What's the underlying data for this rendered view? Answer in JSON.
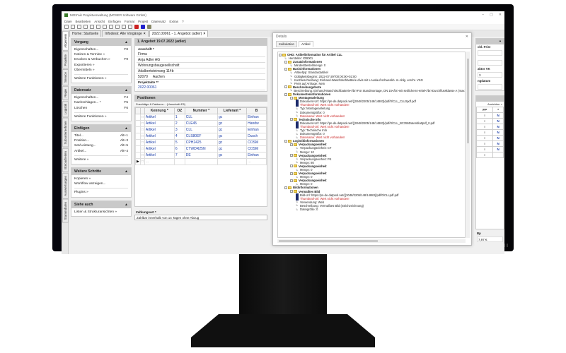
{
  "window": {
    "title": "MOS'aik Projektverwaltung (MOSER Software GmbH)",
    "controls": [
      "–",
      "▢",
      "✕"
    ]
  },
  "menu": [
    "Datei",
    "Bearbeiten",
    "Ansicht",
    "Einfügen",
    "Format",
    "Projekt",
    "Datensatz",
    "Extras",
    "?"
  ],
  "side_tabs": [
    "Allgemein",
    "Projekte",
    "Service",
    "Regie",
    "Logistik",
    "Subunternehmer",
    "Büroarbeiten",
    "Auswertungen",
    "Stammdaten"
  ],
  "doc_tabs": [
    {
      "label": "Home: Startseite",
      "closable": false
    },
    {
      "label": "Infodesk: Alle Vorgänge",
      "closable": true
    },
    {
      "label": "2022.00061 - 1. Angebot (adler)",
      "closable": true,
      "active": true
    }
  ],
  "panels": [
    {
      "title": "Vorgang",
      "items": [
        {
          "label": "Eigenschaften...",
          "key": "F8"
        },
        {
          "label": "Notizen & Termine »",
          "key": ""
        },
        {
          "label": "Drucken & Verbuchen »",
          "key": "F9"
        },
        {
          "label": "Exportieren »",
          "key": ""
        },
        {
          "label": "Übermitteln »",
          "key": ""
        }
      ],
      "more": "Weitere Funktionen »"
    },
    {
      "title": "Datensatz",
      "items": [
        {
          "label": "Eigenschaften...",
          "key": "F4"
        },
        {
          "label": "Nachschlagen... *",
          "key": "F5"
        },
        {
          "label": "Löschen",
          "key": "F6"
        }
      ],
      "more": "Weitere Funktionen »"
    },
    {
      "title": "Einfügen",
      "items": [
        {
          "label": "Titel...",
          "key": "Alt+1"
        },
        {
          "label": "Position...",
          "key": "Alt+3"
        },
        {
          "label": "Set/Leistung...",
          "key": "Alt+5"
        },
        {
          "label": "Artikel...",
          "key": "Alt+4"
        }
      ],
      "more": "Weitere »"
    },
    {
      "title": "Weitere Schritte",
      "items": [
        {
          "label": "Kopieren »",
          "key": ""
        },
        {
          "label": "Workflow anzeigen...",
          "key": ""
        }
      ],
      "more": "Plugins »"
    },
    {
      "title": "Siehe auch",
      "items": [
        {
          "label": "Listen & Strukturansichten »",
          "key": ""
        }
      ],
      "more": null
    }
  ],
  "document": {
    "header": "1. Angebot 19.07.2022 (adler)",
    "address_label": "Anschrift *",
    "address_lines": [
      "Firma",
      "Anja Adler AG",
      "Wohnungsbaugesellschaft",
      "Adalbertsteinweg 114b"
    ],
    "zip": "52070",
    "city": "Aachen",
    "project_label": "Projektakte **",
    "project_value": "2022.00061",
    "positions_header": "Positionen",
    "positions_toolbar": "Zuschläge & Faktoren... (Umschalt+F8)",
    "columns": [
      "Kennung *",
      "OZ",
      "Nummer *",
      "Lieferant *",
      "B"
    ],
    "rows": [
      [
        "Artikel",
        "1",
        "CLL",
        "gc",
        "Einhan"
      ],
      [
        "Artikel",
        "2",
        "CLE45",
        "gc",
        "Handw"
      ],
      [
        "Artikel",
        "3",
        "CLL",
        "gc",
        "Einhan"
      ],
      [
        "Artikel",
        "4",
        "CLS80EF",
        "gc",
        "Dusch"
      ],
      [
        "Artikel",
        "5",
        "CPH2425",
        "gc",
        "COSM"
      ],
      [
        "Artikel",
        "6",
        "CTWDR25N",
        "gc",
        "COSM"
      ],
      [
        "Artikel",
        "7",
        "DE",
        "gc",
        "Einhan"
      ]
    ],
    "new_row_placeholder": "...",
    "payment_label": "Zahlungsart *",
    "payment_value": "Zahlbar innerhalb von 14 Tagen ohne Abzug"
  },
  "details": {
    "title": "Details",
    "tabs": [
      "Kalkulation",
      "Artikel"
    ],
    "active_tab": "Artikel",
    "tree": [
      {
        "level": 0,
        "type": "folder",
        "fold": "-",
        "bold": true,
        "text": "OHD: Artikelinformation für Artikel CLL"
      },
      {
        "level": 1,
        "type": "attr",
        "text": "Hersteller: IDB001"
      },
      {
        "level": 1,
        "type": "folder",
        "fold": "-",
        "bold": true,
        "text": "Zusatzinformationen"
      },
      {
        "level": 2,
        "type": "attr",
        "text": "Mindestbestellmenge: 0"
      },
      {
        "level": 1,
        "type": "folder",
        "fold": "-",
        "bold": true,
        "text": "Basisinformationen"
      },
      {
        "level": 2,
        "type": "attr",
        "text": "Artikeltyp: Standardartikel"
      },
      {
        "level": 2,
        "type": "attr",
        "text": "Gültigkeitsbeginn: 2022-07-29T00:00:00+02:00"
      },
      {
        "level": 2,
        "type": "attr",
        "text": "Kurzbeschreibung: Einhand-Waschtischbatterie divis mit LAuslauf schwenkb. m.Ablg. verchr. VSG"
      },
      {
        "level": 2,
        "type": "attr",
        "text": "Preis auf Anfrage: Nein"
      },
      {
        "level": 1,
        "type": "folder",
        "fold": "-",
        "bold": true,
        "text": "Beschreibungstexte"
      },
      {
        "level": 2,
        "type": "attr",
        "text": "Beschreibung: Einhand-Waschtischbatterie</br>Für Standmontage, DN 15</br>mit seitlichem Hebel</br>Durchflussklasse A (max. 0,25l..."
      },
      {
        "level": 1,
        "type": "folder",
        "fold": "-",
        "bold": true,
        "text": "Dokumenteninformationen"
      },
      {
        "level": 2,
        "type": "folder",
        "fold": "-",
        "bold": true,
        "text": "Montageanleitung"
      },
      {
        "level": 3,
        "type": "doc",
        "text": "Dokument-Url: https://pn-de.datpool.net/{{3048/2205/148/14883}/pdf/0/CLL_CLL0pdf.pdf"
      },
      {
        "level": 3,
        "type": "doc",
        "error": true,
        "text": "Thumbnail-Url: Wert nicht vorhanden!"
      },
      {
        "level": 3,
        "type": "attr",
        "text": "Typ: Montageanleitung"
      },
      {
        "level": 3,
        "type": "attr",
        "text": "Dokumentgröße: 0"
      },
      {
        "level": 3,
        "type": "attr",
        "error": true,
        "text": "Dateiname: Wert nicht vorhanden!"
      },
      {
        "level": 2,
        "type": "folder",
        "fold": "-",
        "bold": true,
        "text": "Technische Info"
      },
      {
        "level": 3,
        "type": "doc",
        "text": "Dokument-Url: https://pn-de.datpool.net/{{3048/2205/148/14883}/pdf/0/CLL_BC355Datenblattpdf_0.pdf"
      },
      {
        "level": 3,
        "type": "doc",
        "error": true,
        "text": "Thumbnail-Url: Wert nicht vorhanden!"
      },
      {
        "level": 3,
        "type": "attr",
        "text": "Typ: Technische Info"
      },
      {
        "level": 3,
        "type": "attr",
        "text": "Dokumentgröße: 0"
      },
      {
        "level": 3,
        "type": "attr",
        "error": true,
        "text": "Dateiname: Wert nicht vorhanden!"
      },
      {
        "level": 1,
        "type": "folder",
        "fold": "-",
        "bold": true,
        "text": "Logistikinformationen"
      },
      {
        "level": 2,
        "type": "folder",
        "fold": "-",
        "bold": true,
        "text": "Verpackungseinheit"
      },
      {
        "level": 3,
        "type": "attr",
        "text": "Verpackungseinheit: CT"
      },
      {
        "level": 3,
        "type": "attr",
        "text": "Menge: 10"
      },
      {
        "level": 2,
        "type": "folder",
        "fold": "-",
        "bold": true,
        "text": "Verpackungseinheit"
      },
      {
        "level": 3,
        "type": "attr",
        "text": "Verpackungseinheit: PK"
      },
      {
        "level": 3,
        "type": "attr",
        "text": "Menge: 80"
      },
      {
        "level": 2,
        "type": "folder",
        "fold": "-",
        "bold": true,
        "text": "Verpackungseinheit"
      },
      {
        "level": 3,
        "type": "attr",
        "text": "Menge: 0"
      },
      {
        "level": 2,
        "type": "folder",
        "fold": "-",
        "bold": true,
        "text": "Verpackungseinheit"
      },
      {
        "level": 3,
        "type": "attr",
        "text": "Menge: 0"
      },
      {
        "level": 2,
        "type": "folder",
        "fold": "-",
        "bold": true,
        "text": "Verpackungseinheit"
      },
      {
        "level": 3,
        "type": "attr",
        "text": "Menge: 0"
      },
      {
        "level": 1,
        "type": "folder",
        "fold": "-",
        "bold": true,
        "text": "Bildinformationen"
      },
      {
        "level": 2,
        "type": "folder",
        "fold": "-",
        "bold": true,
        "text": "Vermaßtes Bild"
      },
      {
        "level": 3,
        "type": "doc",
        "text": "Bild-Url: https://pn-de.datpool.net/{{3048/2205/148/14883}/pdf/0/CLLpdf.pdf"
      },
      {
        "level": 3,
        "type": "doc",
        "error": true,
        "text": "Thumbnail-Url: Wert nicht vorhanden!"
      },
      {
        "level": 3,
        "type": "attr",
        "text": "Verwendung: Web"
      },
      {
        "level": 3,
        "type": "attr",
        "text": "Beschreibung: Vermaßtes Bild (Strichzeichnung)"
      },
      {
        "level": 3,
        "type": "attr",
        "text": "Dateigröße: 0"
      }
    ]
  },
  "right_pane": {
    "label_1": "chl.-Frist",
    "label_2": "aktor VK",
    "value_2": "3",
    "label_3": "ngdatum",
    "list_link": "Ansichten »",
    "columns": [
      "FP",
      "*"
    ],
    "rows": [
      [
        "○",
        "N"
      ],
      [
        "○",
        "N"
      ],
      [
        "○",
        "N"
      ],
      [
        "○",
        "N"
      ],
      [
        "○",
        "N"
      ],
      [
        "○",
        "N"
      ],
      [
        "○",
        "N"
      ],
      [
        "○",
        ""
      ]
    ],
    "total_label": "Bp",
    "total_value": "7,97 €"
  }
}
